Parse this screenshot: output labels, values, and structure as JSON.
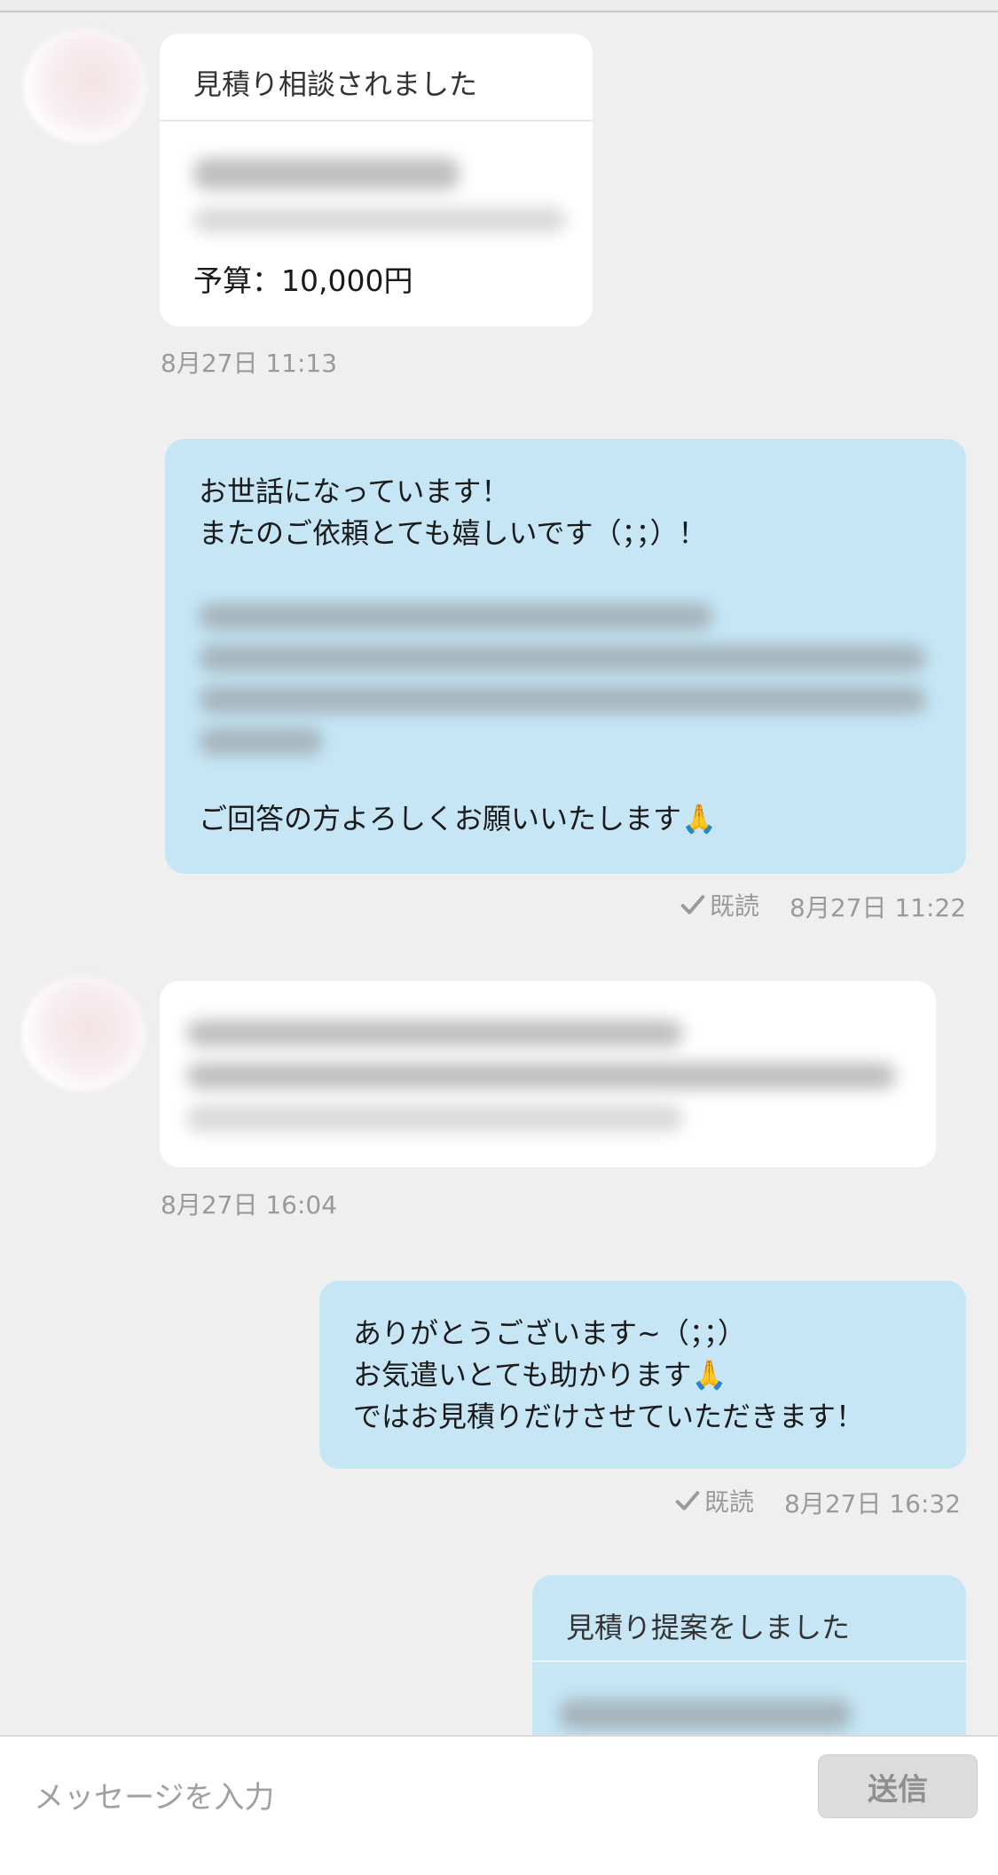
{
  "messages": [
    {
      "type": "incoming-card",
      "header": "見積り相談されました",
      "budget": "予算：10,000円",
      "timestamp": "8月27日 11:13"
    },
    {
      "type": "outgoing",
      "line1": "お世話になっています！",
      "line2": "またのご依頼とても嬉しいです（；；）！",
      "closing": "ご回答の方よろしくお願いいたします🙏",
      "read_label": "既読",
      "timestamp": "8月27日 11:22"
    },
    {
      "type": "incoming",
      "timestamp": "8月27日 16:04"
    },
    {
      "type": "outgoing",
      "text": "ありがとうございます~（；；）\nお気遣いとても助かります🙏\nではお見積りだけさせていただきます！",
      "read_label": "既読",
      "timestamp": "8月27日 16:32"
    },
    {
      "type": "outgoing-card",
      "header": "見積り提案をしました"
    }
  ],
  "composer": {
    "placeholder": "メッセージを入力",
    "send_label": "送信"
  },
  "colors": {
    "background": "#efefef",
    "incoming_bubble": "#ffffff",
    "outgoing_bubble": "#c6e6f6",
    "timestamp": "#9a9a9a"
  },
  "icons": [
    "avatar",
    "check-icon"
  ]
}
